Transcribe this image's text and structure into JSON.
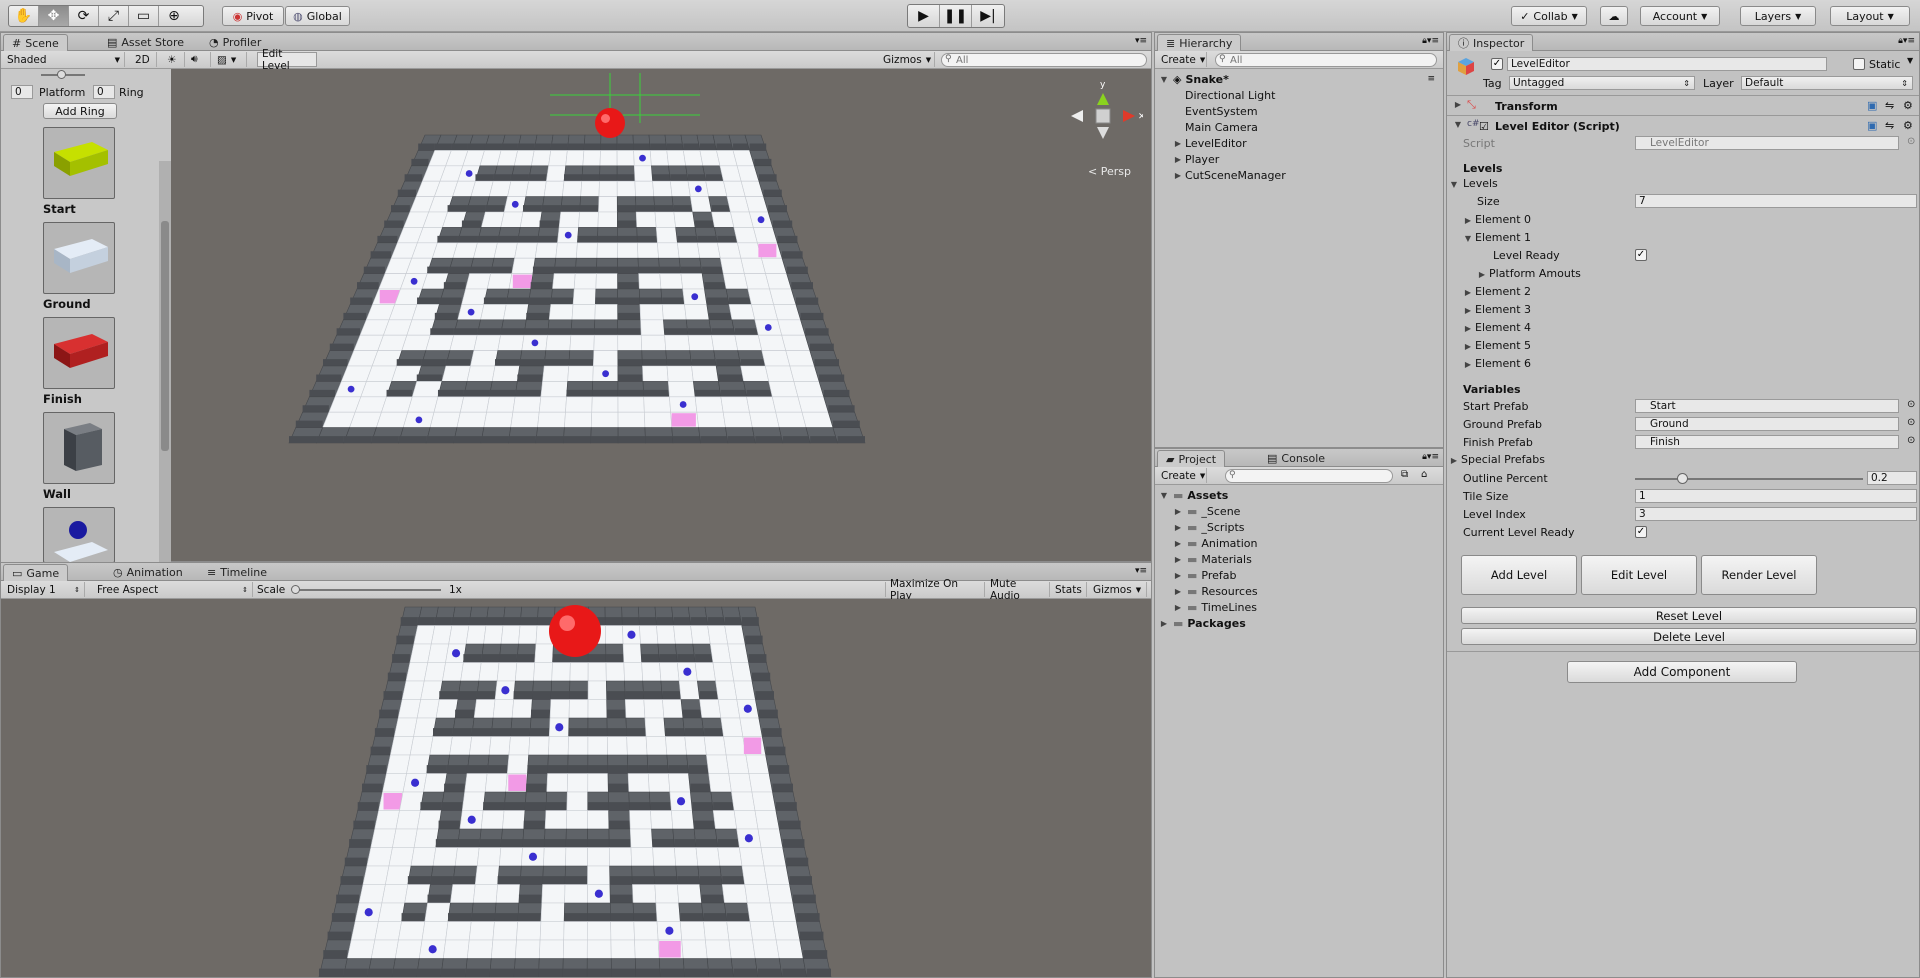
{
  "toolbar": {
    "tools": [
      "hand-icon",
      "move-icon",
      "rotate-icon",
      "scale-icon",
      "rect-icon",
      "transform-icon"
    ],
    "pivot": "Pivot",
    "global": "Global",
    "collab": "Collab",
    "account": "Account",
    "layers": "Layers",
    "layout": "Layout"
  },
  "scene_tabs": {
    "scene": "Scene",
    "asset_store": "Asset Store",
    "profiler": "Profiler"
  },
  "scene_bar": {
    "shading": "Shaded",
    "mode2d": "2D",
    "edit_level": "Edit Level",
    "gizmos": "Gizmos",
    "search_placeholder": "All",
    "persp": "Persp",
    "axis_y": "y"
  },
  "level_tools": {
    "platform_value": "0",
    "platform_label": "Platform",
    "ring_value": "0",
    "ring_label": "Ring",
    "add_ring": "Add Ring",
    "prefabs": [
      "Start",
      "Ground",
      "Finish",
      "Wall"
    ]
  },
  "game_tabs": {
    "game": "Game",
    "animation": "Animation",
    "timeline": "Timeline"
  },
  "game_bar": {
    "display": "Display 1",
    "aspect": "Free Aspect",
    "scale_label": "Scale",
    "scale_value": "1x",
    "maximize": "Maximize On Play",
    "mute": "Mute Audio",
    "stats": "Stats",
    "gizmos": "Gizmos"
  },
  "hierarchy": {
    "title": "Hierarchy",
    "create": "Create",
    "search_placeholder": "All",
    "scene": "Snake*",
    "items": [
      {
        "label": "Directional Light",
        "expandable": false
      },
      {
        "label": "EventSystem",
        "expandable": false
      },
      {
        "label": "Main Camera",
        "expandable": false
      },
      {
        "label": "LevelEditor",
        "expandable": true
      },
      {
        "label": "Player",
        "expandable": true
      },
      {
        "label": "CutSceneManager",
        "expandable": true
      }
    ]
  },
  "project": {
    "tab_project": "Project",
    "tab_console": "Console",
    "create": "Create",
    "assets": "Assets",
    "folders": [
      "_Scene",
      "_Scripts",
      "Animation",
      "Materials",
      "Prefab",
      "Resources",
      "TimeLines"
    ],
    "packages": "Packages"
  },
  "inspector": {
    "title": "Inspector",
    "object_name": "LevelEditor",
    "static": "Static",
    "tag_label": "Tag",
    "tag_value": "Untagged",
    "layer_label": "Layer",
    "layer_value": "Default",
    "transform": "Transform",
    "component": "Level Editor (Script)",
    "script_label": "Script",
    "script_value": "LevelEditor",
    "levels_header": "Levels",
    "levels_foldout": "Levels",
    "size_label": "Size",
    "size_value": "7",
    "elements": [
      "Element 0",
      "Element 1",
      "Element 2",
      "Element 3",
      "Element 4",
      "Element 5",
      "Element 6"
    ],
    "level_ready": "Level Ready",
    "platform_amounts": "Platform Amouts",
    "variables_header": "Variables",
    "start_prefab_label": "Start Prefab",
    "start_prefab_value": "Start",
    "ground_prefab_label": "Ground Prefab",
    "ground_prefab_value": "Ground",
    "finish_prefab_label": "Finish Prefab",
    "finish_prefab_value": "Finish",
    "special_prefabs": "Special Prefabs",
    "outline_label": "Outline Percent",
    "outline_value": "0.2",
    "tile_label": "Tile Size",
    "tile_value": "1",
    "index_label": "Level Index",
    "index_value": "3",
    "current_ready_label": "Current Level Ready",
    "add_level": "Add Level",
    "edit_level": "Edit Level",
    "render_level": "Render Level",
    "reset_level": "Reset Level",
    "delete_level": "Delete Level",
    "add_component": "Add Component"
  }
}
